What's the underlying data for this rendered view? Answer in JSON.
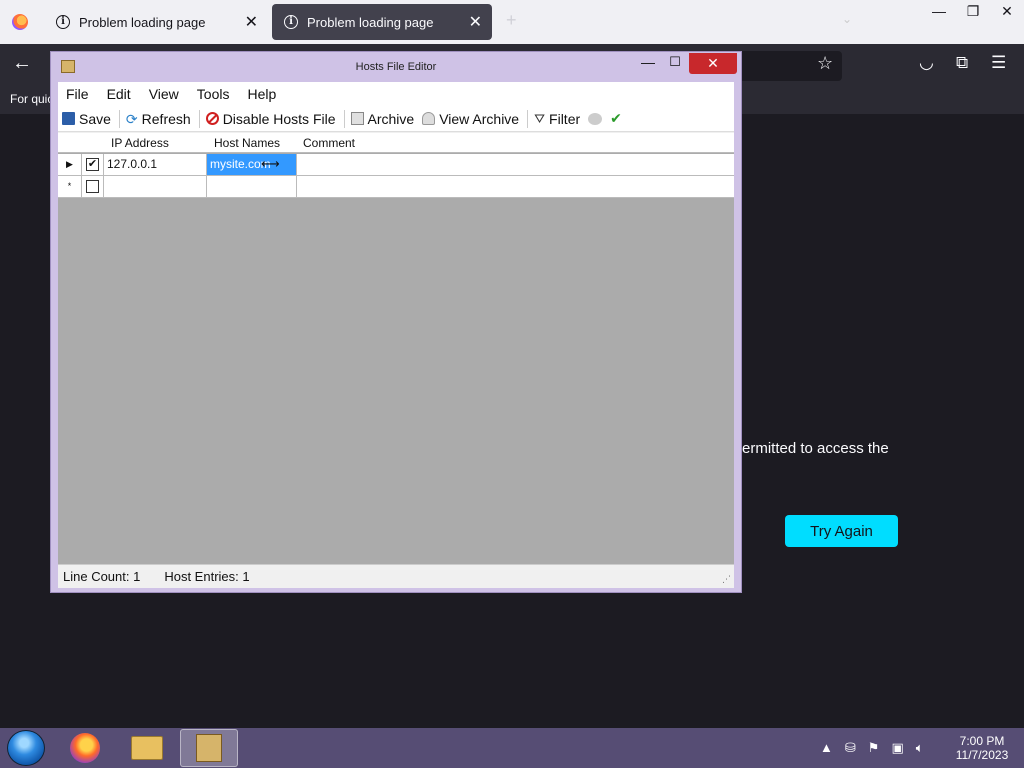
{
  "browser": {
    "tabs": [
      {
        "label": "Problem loading page",
        "close": "✕"
      },
      {
        "label": "Problem loading page",
        "close": "✕"
      }
    ],
    "bookmarks_hint": "For quic",
    "page_fragment": "ermitted to access the",
    "try_again": "Try Again",
    "window_controls": {
      "minimize": "—",
      "restore": "❐",
      "close": "✕"
    }
  },
  "editor": {
    "title": "Hosts File Editor",
    "title_controls": {
      "minimize": "—",
      "maximize": "☐",
      "close": "✕"
    },
    "menu": [
      "File",
      "Edit",
      "View",
      "Tools",
      "Help"
    ],
    "toolbar": {
      "save": "Save",
      "refresh": "Refresh",
      "disable": "Disable Hosts File",
      "archive": "Archive",
      "view_archive": "View Archive",
      "filter": "Filter"
    },
    "columns": {
      "ip": "IP Address",
      "host": "Host Names",
      "comment": "Comment"
    },
    "rows": [
      {
        "marker": "▶",
        "checked": "✔",
        "ip": "127.0.0.1",
        "host": "mysite.com",
        "comment": ""
      },
      {
        "marker": "*",
        "checked": "",
        "ip": "",
        "host": "",
        "comment": ""
      }
    ],
    "status": {
      "line_count": "Line Count:  1",
      "host_entries": "Host Entries:  1"
    }
  },
  "taskbar": {
    "clock_time": "7:00 PM",
    "clock_date": "11/7/2023"
  },
  "colors": {
    "try_again_bg": "#00ddff",
    "selected_cell": "#3399ff",
    "close_button": "#c8282c",
    "taskbar": "#564d74"
  }
}
